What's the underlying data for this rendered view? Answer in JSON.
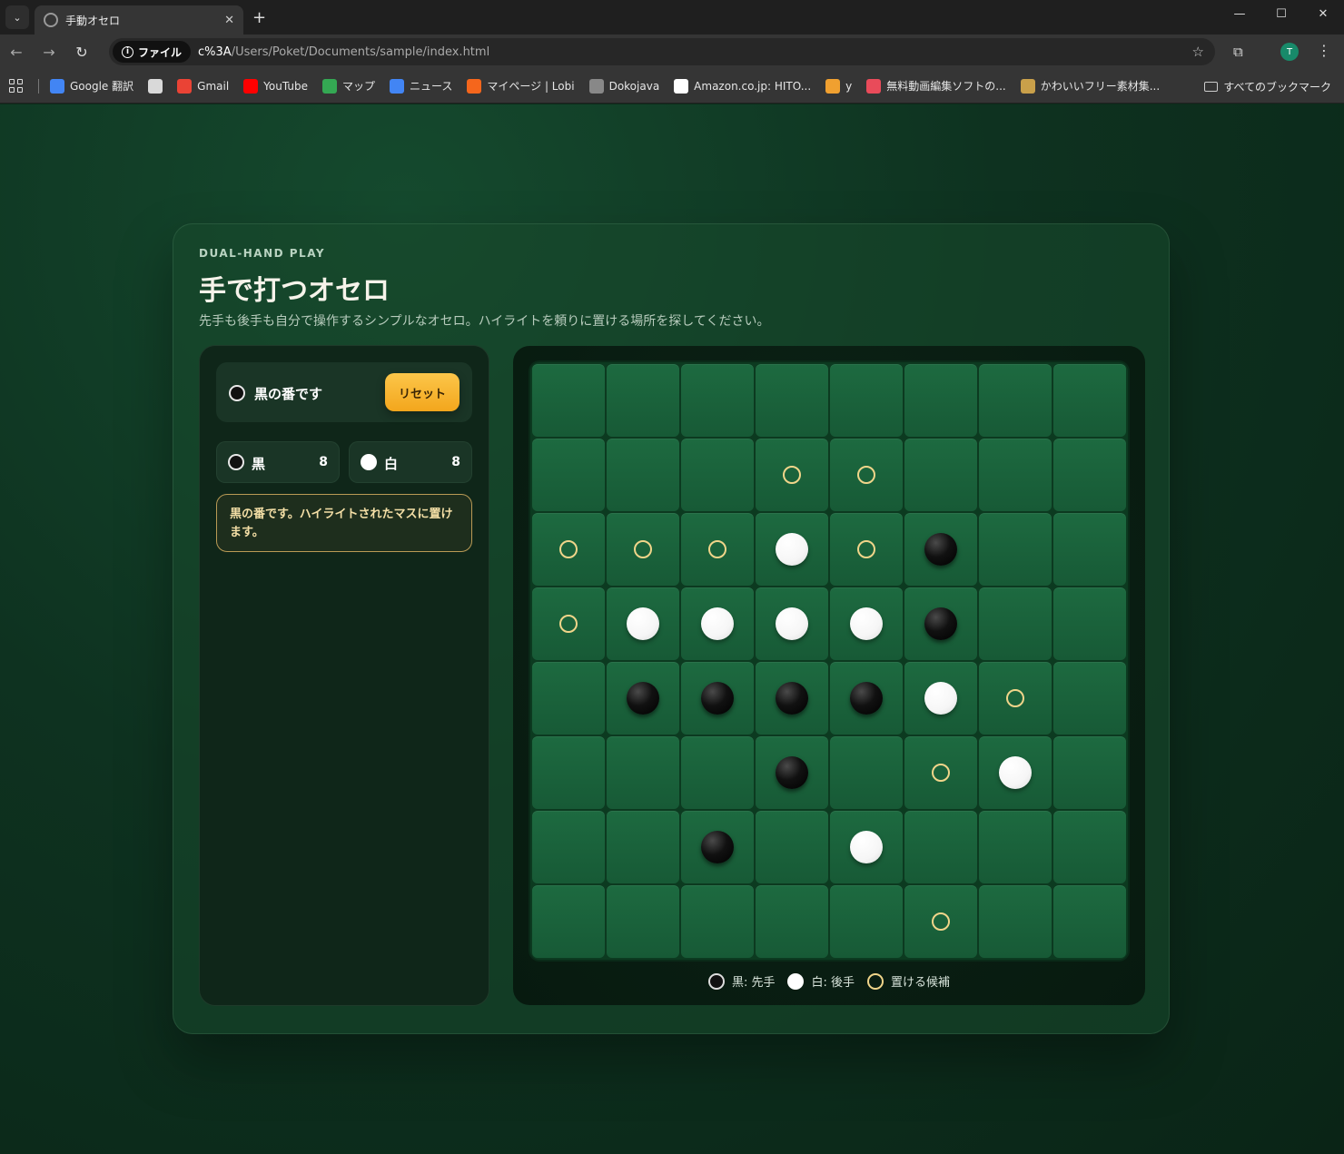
{
  "browser": {
    "tab_title": "手動オセロ",
    "security_chip": "ファイル",
    "url_host": "c%3A",
    "url_path": "/Users/Poket/Documents/sample/index.html",
    "profile_initial": "T",
    "bookmarks": [
      {
        "label": "Google 翻訳",
        "icon": "google-translate-icon",
        "color": "#4285f4"
      },
      {
        "label": "",
        "icon": "cat-icon",
        "color": "#d9d9d9"
      },
      {
        "label": "Gmail",
        "icon": "gmail-icon",
        "color": "#ea4335"
      },
      {
        "label": "YouTube",
        "icon": "youtube-icon",
        "color": "#ff0000"
      },
      {
        "label": "マップ",
        "icon": "maps-pin-icon",
        "color": "#34a853"
      },
      {
        "label": "ニュース",
        "icon": "news-icon",
        "color": "#4285f4"
      },
      {
        "label": "マイページ | Lobi",
        "icon": "lobi-icon",
        "color": "#f5661c"
      },
      {
        "label": "Dokojava",
        "icon": "dokojava-icon",
        "color": "#888888"
      },
      {
        "label": "Amazon.co.jp: HITO...",
        "icon": "amazon-icon",
        "color": "#ffffff"
      },
      {
        "label": "y",
        "icon": "y-icon",
        "color": "#f0a030"
      },
      {
        "label": "無料動画編集ソフトの...",
        "icon": "video-editor-icon",
        "color": "#e94b5a"
      },
      {
        "label": "かわいいフリー素材集...",
        "icon": "irasutoya-icon",
        "color": "#c9a04a"
      }
    ],
    "all_bookmarks": "すべてのブックマーク"
  },
  "header": {
    "eyebrow": "DUAL-HAND PLAY",
    "title": "手で打つオセロ",
    "subtitle": "先手も後手も自分で操作するシンプルなオセロ。ハイライトを頼りに置ける場所を探してください。"
  },
  "status": {
    "turn_label": "黒の番です",
    "current_player": "black",
    "reset_label": "リセット"
  },
  "scores": {
    "black": {
      "name": "黒",
      "count": "8"
    },
    "white": {
      "name": "白",
      "count": "8"
    }
  },
  "message": "黒の番です。ハイライトされたマスに置けます。",
  "board": [
    [
      ".",
      ".",
      ".",
      ".",
      ".",
      ".",
      ".",
      "."
    ],
    [
      ".",
      ".",
      ".",
      "h",
      "h",
      ".",
      ".",
      "."
    ],
    [
      "h",
      "h",
      "h",
      "W",
      "h",
      "B",
      ".",
      "."
    ],
    [
      "h",
      "W",
      "W",
      "W",
      "W",
      "B",
      ".",
      "."
    ],
    [
      ".",
      "B",
      "B",
      "B",
      "B",
      "W",
      "h",
      "."
    ],
    [
      ".",
      ".",
      ".",
      "B",
      ".",
      "h",
      "W",
      "."
    ],
    [
      ".",
      ".",
      "B",
      ".",
      "W",
      ".",
      ".",
      "."
    ],
    [
      ".",
      ".",
      ".",
      ".",
      ".",
      "h",
      ".",
      "."
    ]
  ],
  "legend": {
    "black": "黒: 先手",
    "white": "白: 後手",
    "hint": "置ける候補"
  },
  "colors": {
    "accent": "#f5b22c",
    "hint": "#f0d58a",
    "board": "#1b633c"
  }
}
